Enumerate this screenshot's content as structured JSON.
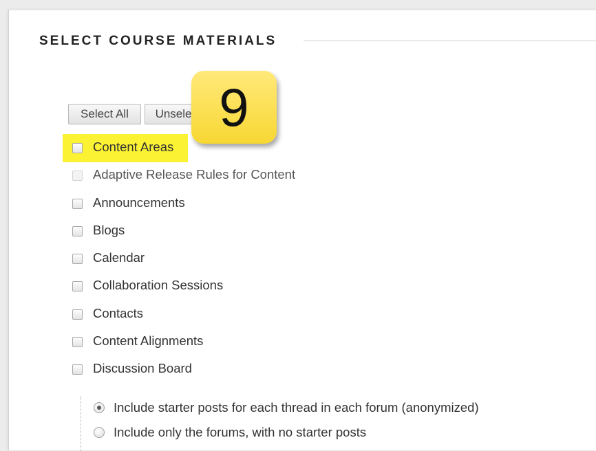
{
  "section": {
    "title": "SELECT COURSE MATERIALS"
  },
  "buttons": {
    "select_all": "Select All",
    "unselect_all": "Unselect All"
  },
  "callout": {
    "number": "9",
    "color": "#f8d733"
  },
  "highlight_color": "#fbf233",
  "materials": [
    {
      "label": "Content Areas",
      "checked": false,
      "disabled": false,
      "highlighted": true
    },
    {
      "label": "Adaptive Release Rules for Content",
      "checked": false,
      "disabled": true,
      "highlighted": false
    },
    {
      "label": "Announcements",
      "checked": false,
      "disabled": false,
      "highlighted": false
    },
    {
      "label": "Blogs",
      "checked": false,
      "disabled": false,
      "highlighted": false
    },
    {
      "label": "Calendar",
      "checked": false,
      "disabled": false,
      "highlighted": false
    },
    {
      "label": "Collaboration Sessions",
      "checked": false,
      "disabled": false,
      "highlighted": false
    },
    {
      "label": "Contacts",
      "checked": false,
      "disabled": false,
      "highlighted": false
    },
    {
      "label": "Content Alignments",
      "checked": false,
      "disabled": false,
      "highlighted": false
    },
    {
      "label": "Discussion Board",
      "checked": false,
      "disabled": false,
      "highlighted": false
    }
  ],
  "discussion_options": [
    {
      "label": "Include starter posts for each thread in each forum (anonymized)",
      "selected": true
    },
    {
      "label": "Include only the forums, with no starter posts",
      "selected": false
    }
  ]
}
